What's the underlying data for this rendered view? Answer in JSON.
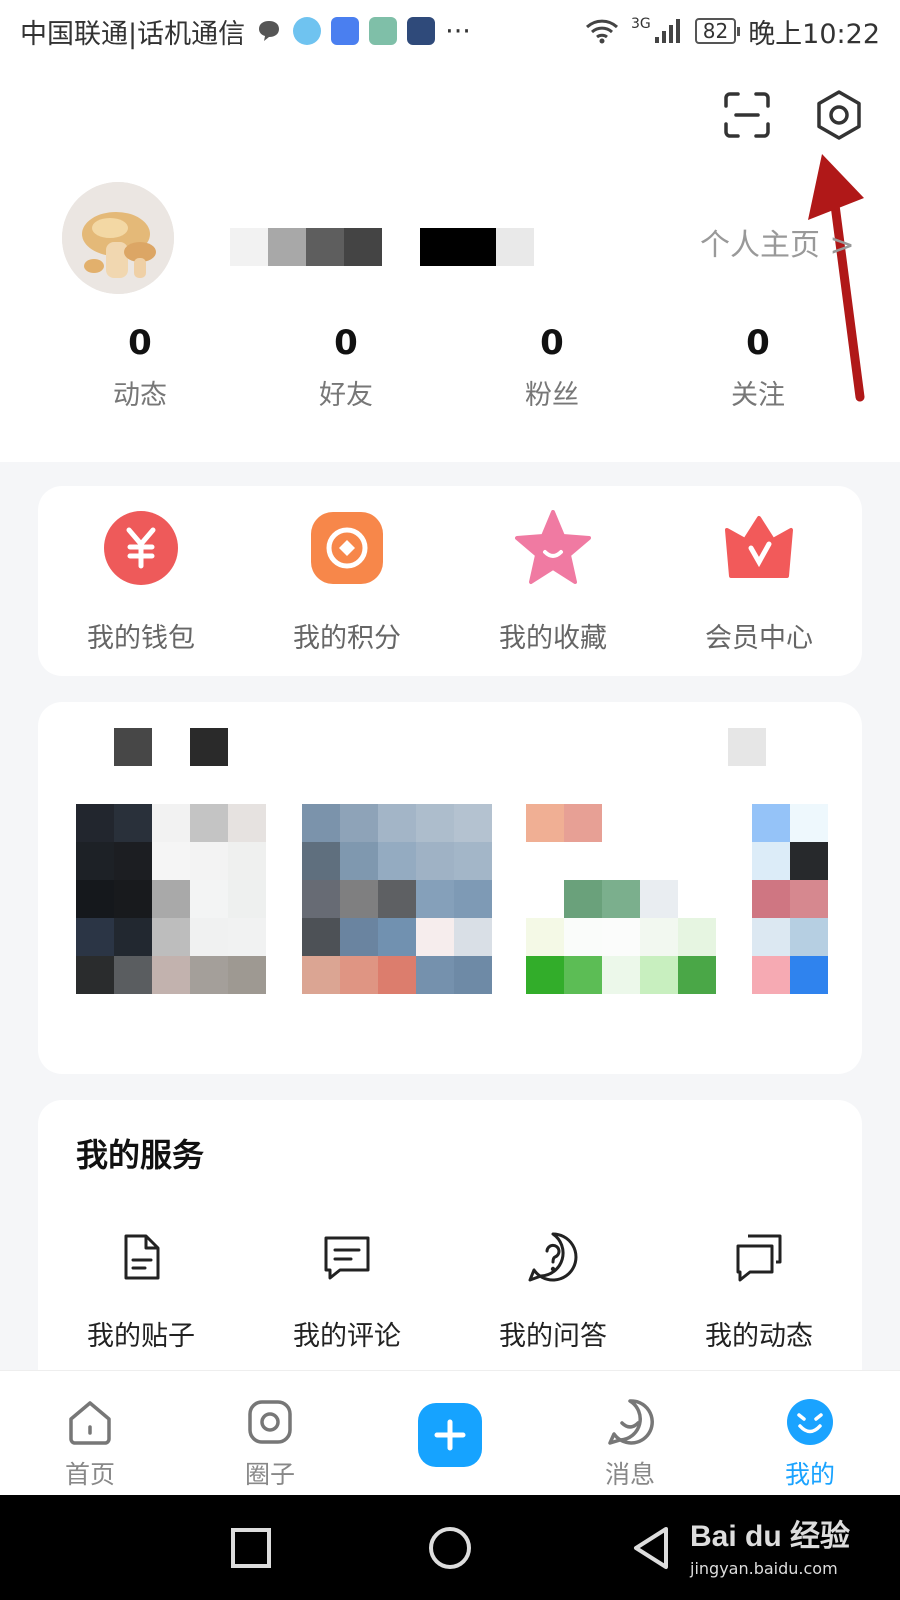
{
  "status_bar": {
    "carrier": "中国联通|话机通信",
    "overflow": "···",
    "network": "3G",
    "battery": "82",
    "time": "晚上10:22"
  },
  "header": {
    "profile_link": "个人主页 >",
    "stats": [
      {
        "value": "0",
        "label": "动态"
      },
      {
        "value": "0",
        "label": "好友"
      },
      {
        "value": "0",
        "label": "粉丝"
      },
      {
        "value": "0",
        "label": "关注"
      }
    ]
  },
  "quick_actions": [
    {
      "label": "我的钱包",
      "icon": "wallet-yen-icon",
      "color": "#ee5a5a"
    },
    {
      "label": "我的积分",
      "icon": "points-icon",
      "color": "#f7874a"
    },
    {
      "label": "我的收藏",
      "icon": "star-icon",
      "color": "#f07aa2"
    },
    {
      "label": "会员中心",
      "icon": "crown-icon",
      "color": "#f25a5a"
    }
  ],
  "services": {
    "title": "我的服务",
    "items": [
      {
        "label": "我的贴子",
        "icon": "document-icon"
      },
      {
        "label": "我的评论",
        "icon": "comment-icon"
      },
      {
        "label": "我的问答",
        "icon": "question-icon"
      },
      {
        "label": "我的动态",
        "icon": "chat-bubbles-icon"
      }
    ]
  },
  "tabbar": {
    "tabs": [
      {
        "label": "首页",
        "icon": "home-icon"
      },
      {
        "label": "圈子",
        "icon": "circle-icon"
      },
      {
        "label": "",
        "icon": "plus-icon"
      },
      {
        "label": "消息",
        "icon": "message-icon"
      },
      {
        "label": "我的",
        "icon": "smiley-icon"
      }
    ],
    "active_color": "#1aa3ff"
  },
  "watermark": {
    "main": "Bai du 经验",
    "sub": "jingyan.baidu.com"
  }
}
